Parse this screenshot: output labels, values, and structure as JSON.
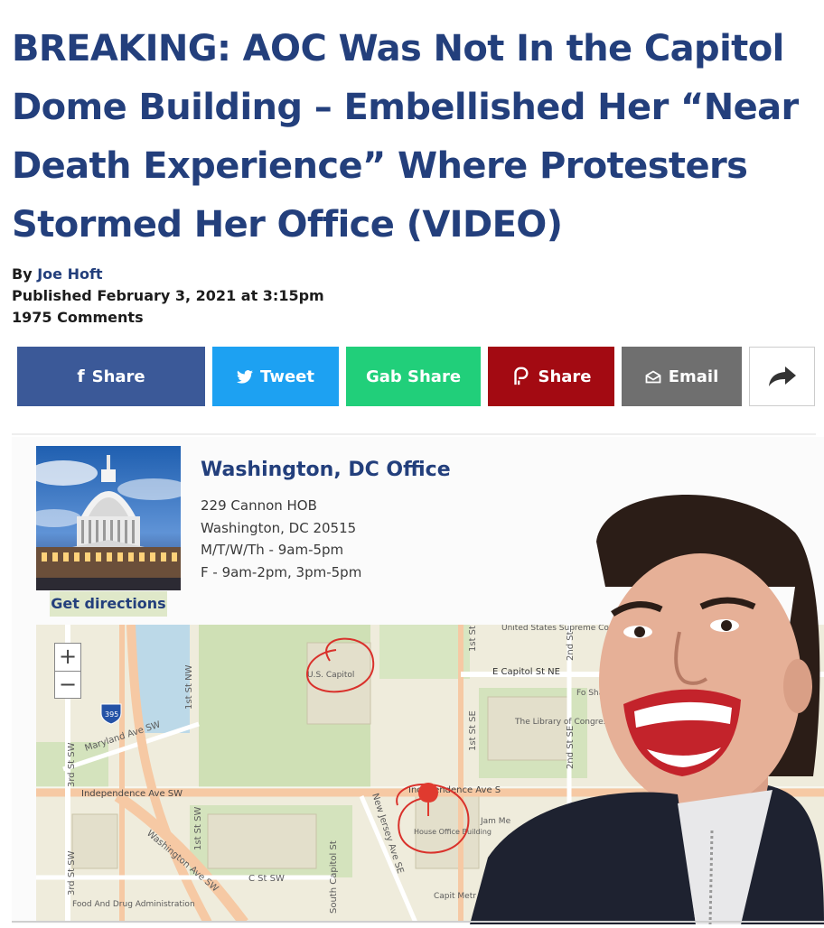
{
  "article": {
    "headline_lines": [
      "BREAKING: AOC Was Not In the Capitol",
      "Dome Building – Embellished Her “Near",
      "Death Experience” Where Protesters",
      "Stormed Her Office (VIDEO)"
    ],
    "by_prefix": "By",
    "author": "Joe Hoft",
    "published": "Published February 3, 2021 at 3:15pm",
    "comments": "1975 Comments"
  },
  "share_buttons": [
    {
      "label": "Share",
      "icon": "facebook-icon",
      "glyph": "f",
      "color": "#3b5998"
    },
    {
      "label": "Tweet",
      "icon": "twitter-icon",
      "glyph": "🐦",
      "color": "#1da1f2"
    },
    {
      "label": "Gab Share",
      "icon": "",
      "glyph": "",
      "color": "#21cf7a"
    },
    {
      "label": "Share",
      "icon": "parler-icon",
      "glyph": "P",
      "color": "#a30a12"
    },
    {
      "label": "Email",
      "icon": "envelope-icon",
      "glyph": "✉",
      "color": "#6f6f6f"
    },
    {
      "label": "",
      "icon": "share-arrow-icon",
      "glyph": "➦",
      "color": "#ffffff"
    }
  ],
  "office": {
    "title": "Washington, DC Office",
    "lines": [
      "229 Cannon HOB",
      "Washington, DC 20515",
      "M/T/W/Th - 9am-5pm",
      "F - 9am-2pm, 3pm-5pm"
    ],
    "directions_label": "Get directions"
  },
  "map": {
    "zoom_in": "+",
    "zoom_out": "−",
    "labels": {
      "us_capitol": "U.S. Capitol",
      "supreme_court": "United States Supreme Court",
      "e_capitol": "E Capitol St NE",
      "library": "The Library of Congress",
      "maryland": "Maryland Ave SW",
      "independence_left": "Independence Ave SW",
      "independence_right": "Independence Ave S",
      "washington_ave": "Washington Ave SW",
      "c_st": "C St SW",
      "house_office": "House Office Building",
      "food_drug": "Food And Drug Administration",
      "st_1st_nw": "1st St NW",
      "st_3rd_sw_a": "3rd St SW",
      "st_3rd_sw_b": "3rd St SW",
      "st_1st_sw": "1st St SW",
      "st_1st_se": "1st St SE",
      "st_1st": "1st St",
      "st_2nd_a": "2nd St",
      "st_2nd_se": "2nd St SE",
      "south_capitol": "South Capitol St",
      "new_jersey": "New Jersey Ave SE",
      "shield": "395",
      "capitol_metro": "Capit Metr",
      "fo": "Fo Shake The",
      "jam": "Jam Me"
    }
  },
  "colors": {
    "headline": "#233f7c",
    "map_bg": "#efecdc",
    "park": "#cfe0b5",
    "road": "#f6c9a4",
    "annotation_circle": "#d9312b"
  }
}
